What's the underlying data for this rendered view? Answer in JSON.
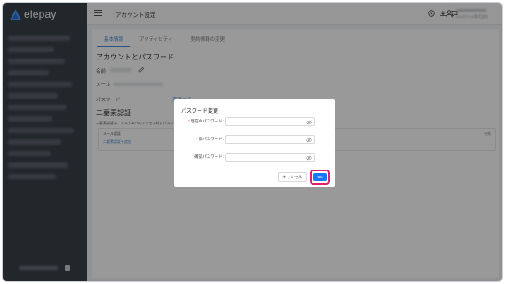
{
  "app": {
    "name": "elepay"
  },
  "header": {
    "title": "アカウント設定",
    "company": "ELESTYLE株式会社",
    "icons": [
      "clock-icon",
      "download-icon",
      "chat-icon",
      "user-icon"
    ]
  },
  "tabs": [
    {
      "label": "基本情報"
    },
    {
      "label": "アクティビティ"
    },
    {
      "label": "契約情報の変更"
    }
  ],
  "account": {
    "title": "アカウントとパスワード",
    "name_label": "名前",
    "email_label": "メール",
    "password_label": "パスワード",
    "password_change_link": "変更する"
  },
  "twofa": {
    "title": "二要素認証",
    "description": "二要素認証は、システムへのアクセス時にパスワ",
    "box_label": "メール認証",
    "box_link": "二要素認証を追加",
    "box_status": "有効"
  },
  "modal": {
    "title": "パスワード変更",
    "required_mark": "*",
    "fields": [
      {
        "label": "現在のパスワード:"
      },
      {
        "label": "新パスワード:"
      },
      {
        "label": "確認パスワード:"
      }
    ],
    "cancel_label": "キャンセル",
    "ok_label": "OK"
  },
  "colors": {
    "sidebar": "#3a4149",
    "accent": "#4a8bd6",
    "primary_button": "#1677ff",
    "highlight_ring": "#e11f6e"
  }
}
